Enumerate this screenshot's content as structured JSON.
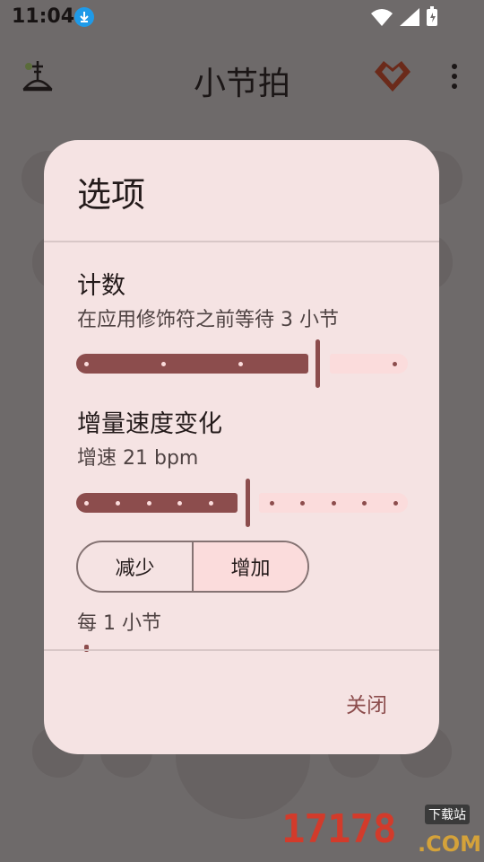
{
  "status_bar": {
    "time": "11:04"
  },
  "app": {
    "title": "小节拍"
  },
  "dialog": {
    "title": "选项",
    "count": {
      "title": "计数",
      "subtitle": "在应用修饰符之前等待 3 小节",
      "value": 3
    },
    "tempo": {
      "title": "增量速度变化",
      "subtitle": "增速 21 bpm",
      "value": 21
    },
    "direction": {
      "options": [
        "减少",
        "增加"
      ],
      "selected": "增加"
    },
    "per_bar": "每 1 小节",
    "close_label": "关闭"
  },
  "watermark": {
    "text": "17178",
    "suffix": ".COM",
    "tag": "下载站"
  },
  "colors": {
    "accent": "#8c4d4d",
    "dialog_bg": "#f5e3e3",
    "track_inactive": "#fbdcdc",
    "scrim_bg": "#6e6a6a"
  }
}
